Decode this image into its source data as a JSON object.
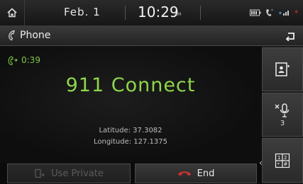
{
  "status": {
    "date": "Feb.  1",
    "time": "10:29",
    "ampm": "AM"
  },
  "titlebar": {
    "title": "Phone"
  },
  "call": {
    "duration": "0:39",
    "name": "911 Connect",
    "latitude_label": "Latitude: 37.3082",
    "longitude_label": "Longitude: 127.1375"
  },
  "side": {
    "mute_count": "3"
  },
  "bottom": {
    "use_private_label": "Use Private",
    "end_label": "End"
  },
  "colors": {
    "accent_green": "#8fd64a",
    "end_red": "#d63030",
    "status_red": "#e03030"
  },
  "icons": [
    "home-icon",
    "battery-icon",
    "bluetooth-phone-icon",
    "signal-icon",
    "alert-icon",
    "phone-icon",
    "back-icon",
    "call-active-icon",
    "contacts-icon",
    "mic-mute-icon",
    "keypad-icon",
    "private-phone-icon",
    "end-call-icon"
  ]
}
